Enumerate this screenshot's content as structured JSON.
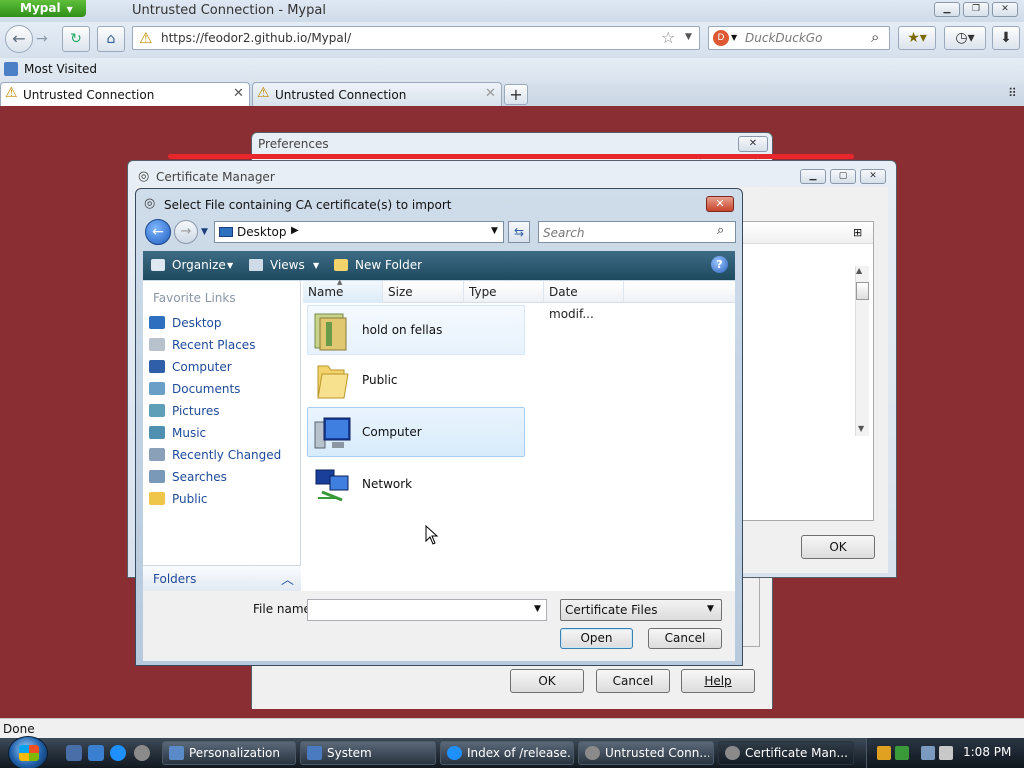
{
  "browser": {
    "app_menu": "Mypal",
    "window_title": "Untrusted Connection - Mypal",
    "url": "https://feodor2.github.io/Mypal/",
    "search_engine": "DuckDuckGo",
    "bookmark_label": "Most Visited",
    "tabs": [
      {
        "label": "Untrusted Connection"
      },
      {
        "label": "Untrusted Connection"
      }
    ],
    "status": "Done"
  },
  "preferences": {
    "title": "Preferences"
  },
  "cert_manager": {
    "title": "Certificate Manager",
    "ok_label": "OK"
  },
  "file_dialog": {
    "title": "Select File containing CA certificate(s) to import",
    "location": "Desktop",
    "search_placeholder": "Search",
    "toolbar": {
      "organize": "Organize",
      "views": "Views",
      "new_folder": "New Folder"
    },
    "favorite_links_header": "Favorite Links",
    "favorite_links": [
      {
        "label": "Desktop",
        "icon": "desktop-icon"
      },
      {
        "label": "Recent Places",
        "icon": "recent-places-icon"
      },
      {
        "label": "Computer",
        "icon": "computer-icon"
      },
      {
        "label": "Documents",
        "icon": "documents-icon"
      },
      {
        "label": "Pictures",
        "icon": "pictures-icon"
      },
      {
        "label": "Music",
        "icon": "music-icon"
      },
      {
        "label": "Recently Changed",
        "icon": "recently-changed-icon"
      },
      {
        "label": "Searches",
        "icon": "searches-icon"
      },
      {
        "label": "Public",
        "icon": "public-folder-icon"
      }
    ],
    "folders_label": "Folders",
    "columns": [
      "Name",
      "Size",
      "Type",
      "Date modif..."
    ],
    "items": [
      {
        "label": "hold on fellas",
        "icon": "folder-icon"
      },
      {
        "label": "Public",
        "icon": "folder-icon"
      },
      {
        "label": "Computer",
        "icon": "computer-icon"
      },
      {
        "label": "Network",
        "icon": "network-icon"
      }
    ],
    "file_name_label": "File name:",
    "file_name_value": "",
    "file_type": "Certificate Files",
    "open_label": "Open",
    "cancel_label": "Cancel"
  },
  "prefs_buttons": {
    "ok": "OK",
    "cancel": "Cancel",
    "help": "Help"
  },
  "taskbar": {
    "buttons": [
      {
        "label": "Personalization"
      },
      {
        "label": "System"
      },
      {
        "label": "Index of /release..."
      },
      {
        "label": "Untrusted Conn..."
      },
      {
        "label": "Certificate Man..."
      }
    ],
    "clock": "1:08 PM"
  }
}
